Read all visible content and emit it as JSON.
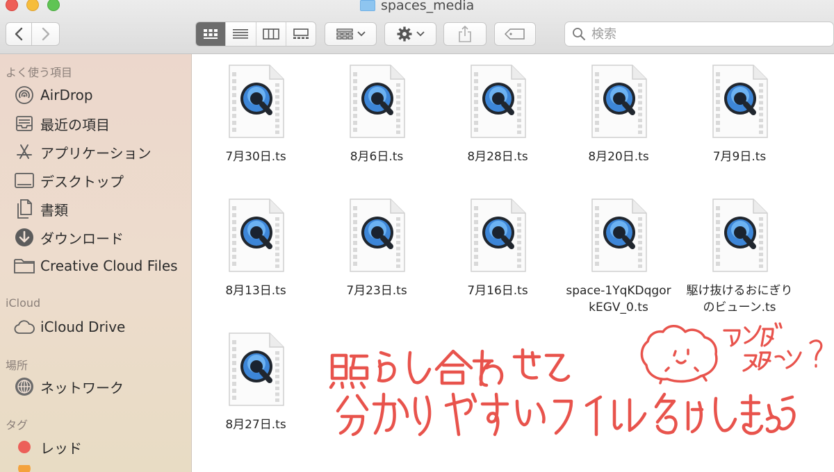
{
  "window": {
    "title": "spaces_media"
  },
  "toolbar": {
    "search_placeholder": "検索"
  },
  "sidebar": {
    "favorites_header": "よく使う項目",
    "favorites": [
      {
        "label": "AirDrop",
        "icon": "airdrop-icon"
      },
      {
        "label": "最近の項目",
        "icon": "recents-icon"
      },
      {
        "label": "アプリケーション",
        "icon": "applications-icon"
      },
      {
        "label": "デスクトップ",
        "icon": "desktop-icon"
      },
      {
        "label": "書類",
        "icon": "documents-icon"
      },
      {
        "label": "ダウンロード",
        "icon": "downloads-icon"
      },
      {
        "label": "Creative Cloud Files",
        "icon": "folder-icon"
      }
    ],
    "icloud_header": "iCloud",
    "icloud": [
      {
        "label": "iCloud Drive",
        "icon": "cloud-icon"
      }
    ],
    "locations_header": "場所",
    "locations": [
      {
        "label": "ネットワーク",
        "icon": "network-icon"
      }
    ],
    "tags_header": "タグ",
    "tags": [
      {
        "label": "レッド",
        "color": "#ec5f59"
      }
    ]
  },
  "files": [
    {
      "name": "7月30日.ts",
      "name2": ""
    },
    {
      "name": "8月6日.ts",
      "name2": ""
    },
    {
      "name": "8月28日.ts",
      "name2": ""
    },
    {
      "name": "8月20日.ts",
      "name2": ""
    },
    {
      "name": "7月9日.ts",
      "name2": ""
    },
    {
      "name": "8月13日.ts",
      "name2": ""
    },
    {
      "name": "7月23日.ts",
      "name2": ""
    },
    {
      "name": "7月16日.ts",
      "name2": ""
    },
    {
      "name": "space-1YqKDqgor",
      "name2": "kEGV_0.ts"
    },
    {
      "name": "駆け抜けるおにぎり",
      "name2": "のビューン.ts"
    },
    {
      "name": "8月27日.ts",
      "name2": ""
    }
  ],
  "annotation": {
    "line1": "照らし合わせて",
    "line2": "分かりやすいファイル名にしましょう",
    "bubble1": "アンダ",
    "bubble2": "スターン?",
    "ink_color": "#e8534c"
  }
}
